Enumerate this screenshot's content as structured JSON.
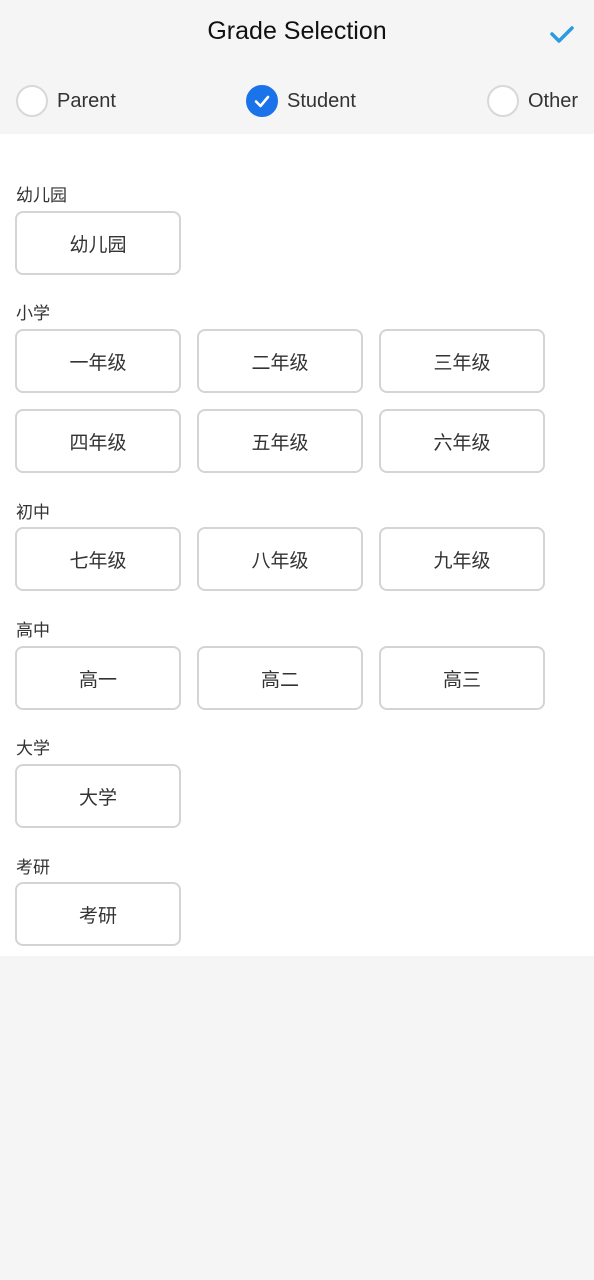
{
  "header": {
    "title": "Grade Selection",
    "confirm_icon": "checkmark-icon",
    "accent_color": "#2a9be0"
  },
  "roles": {
    "selected": "Student",
    "selected_color": "#1a73e8",
    "items": [
      {
        "label": "Parent",
        "checked": false
      },
      {
        "label": "Student",
        "checked": true
      },
      {
        "label": "Other",
        "checked": false
      }
    ]
  },
  "sections": [
    {
      "label": "幼儿园",
      "grades": [
        "幼儿园"
      ]
    },
    {
      "label": "小学",
      "grades": [
        "一年级",
        "二年级",
        "三年级",
        "四年级",
        "五年级",
        "六年级"
      ]
    },
    {
      "label": "初中",
      "grades": [
        "七年级",
        "八年级",
        "九年级"
      ]
    },
    {
      "label": "高中",
      "grades": [
        "高一",
        "高二",
        "高三"
      ]
    },
    {
      "label": "大学",
      "grades": [
        "大学"
      ]
    },
    {
      "label": "考研",
      "grades": [
        "考研"
      ]
    }
  ]
}
